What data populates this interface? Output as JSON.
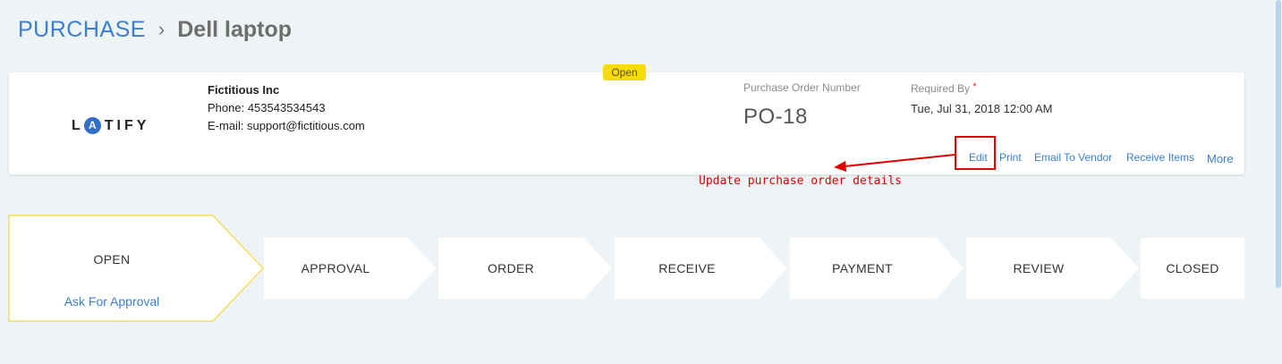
{
  "breadcrumb": {
    "root": "PURCHASE",
    "separator": "›",
    "current": "Dell laptop"
  },
  "status_badge": "Open",
  "vendor": {
    "logo_text": "L A T I F Y",
    "name": "Fictitious Inc",
    "phone": "Phone: 453543534543",
    "email": "E-mail: support@fictitious.com"
  },
  "po": {
    "number_label": "Purchase Order Number",
    "number": "PO-18",
    "required_label": "Required By",
    "required_star": "*",
    "required_value": "Tue, Jul 31, 2018 12:00 AM"
  },
  "actions": {
    "edit": "Edit",
    "print": "Print",
    "email_vendor": "Email To Vendor",
    "receive_items": "Receive Items",
    "more": "More"
  },
  "annotation": {
    "text": "Update purchase order details"
  },
  "stages": {
    "open": "OPEN",
    "open_action": "Ask For Approval",
    "approval": "APPROVAL",
    "order": "ORDER",
    "receive": "RECEIVE",
    "payment": "PAYMENT",
    "review": "REVIEW",
    "closed": "CLOSED"
  },
  "colors": {
    "accent": "#3b7fd1",
    "badge": "#f7dc0b",
    "annotation": "#e00000",
    "active_stage_border": "#f0dc3c"
  }
}
